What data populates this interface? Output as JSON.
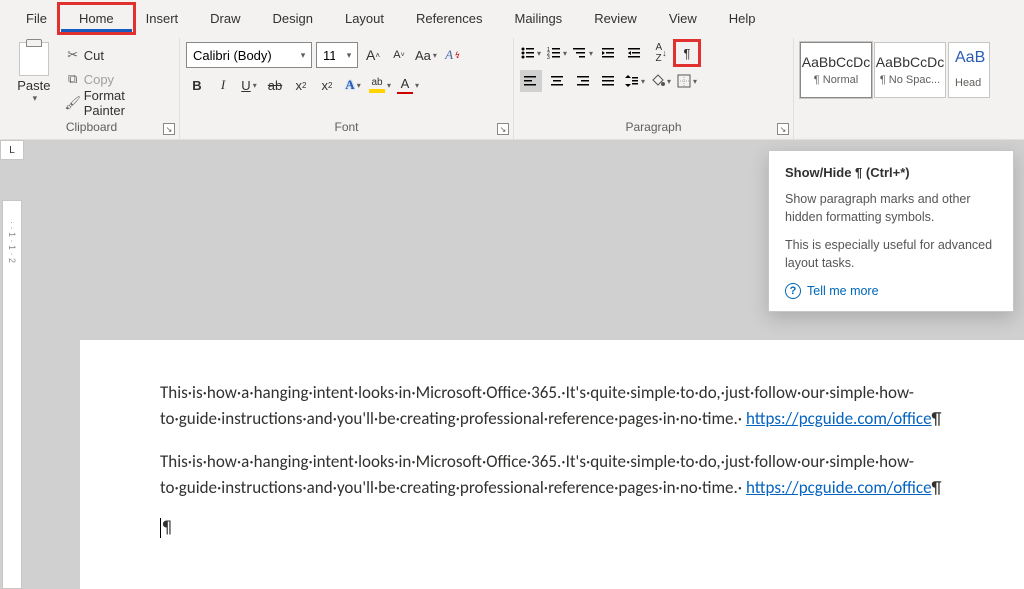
{
  "tabs": [
    "File",
    "Home",
    "Insert",
    "Draw",
    "Design",
    "Layout",
    "References",
    "Mailings",
    "Review",
    "View",
    "Help"
  ],
  "activeTab": 1,
  "clipboard": {
    "paste": "Paste",
    "cut": "Cut",
    "copy": "Copy",
    "format_painter": "Format Painter",
    "group": "Clipboard"
  },
  "font": {
    "name": "Calibri (Body)",
    "size": "11",
    "bold": "B",
    "italic": "I",
    "group": "Font"
  },
  "paragraph": {
    "group": "Paragraph"
  },
  "styles": {
    "sample": "AaBbCcDc",
    "normal": "¶ Normal",
    "nospacing": "¶ No Spac...",
    "heading": "Head",
    "sample_h": "AaB"
  },
  "tooltip": {
    "title": "Show/Hide ¶ (Ctrl+*)",
    "p1": "Show paragraph marks and other hidden formatting symbols.",
    "p2": "This is especially useful for advanced layout tasks.",
    "link": "Tell me more"
  },
  "doc": {
    "para1": "This·is·how·a·hanging·intent·looks·in·Microsoft·Office·365.·It's·quite·simple·to·do,·just·follow·our·simple·how-to·guide·instructions·and·you'll·be·creating·professional·reference·pages·in·no·time.·",
    "link": "https://pcguide.com/office",
    "pilcrow": "¶",
    "cursor": "¶"
  },
  "ruler": {
    "corner": "L",
    "marks": "· · 1 · 1 · 2"
  }
}
